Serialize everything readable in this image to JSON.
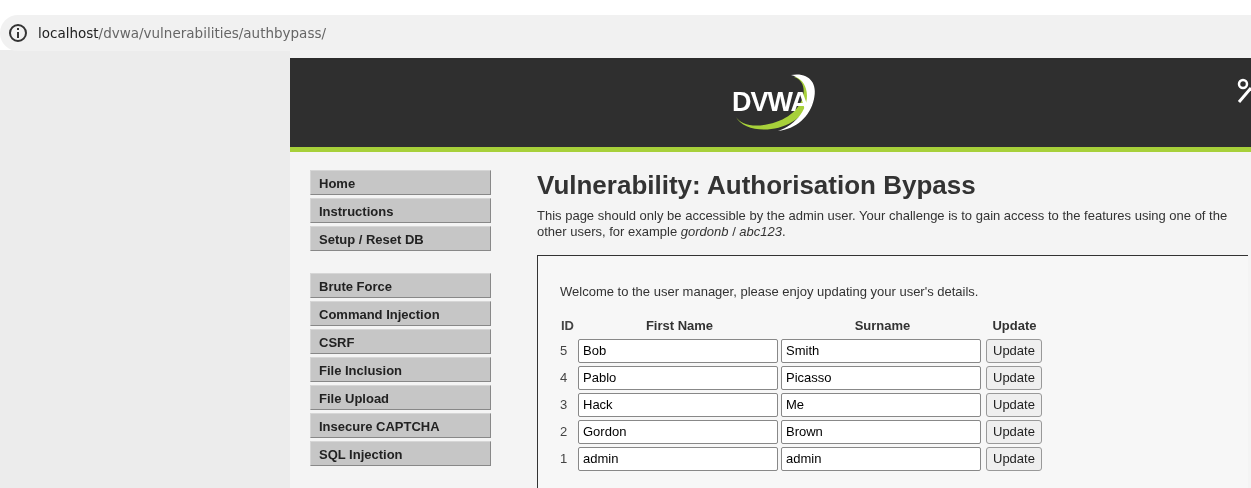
{
  "browser": {
    "url": "**localhost**/dvwa/vulnerabilities/authbypass/"
  },
  "header": {
    "logo_text": "DVWA"
  },
  "menu": [
    {
      "items": [
        {
          "label": "Home"
        },
        {
          "label": "Instructions"
        },
        {
          "label": "Setup / Reset DB"
        }
      ]
    },
    {
      "items": [
        {
          "label": "Brute Force"
        },
        {
          "label": "Command Injection"
        },
        {
          "label": "CSRF"
        },
        {
          "label": "File Inclusion"
        },
        {
          "label": "File Upload"
        },
        {
          "label": "Insecure CAPTCHA"
        },
        {
          "label": "SQL Injection"
        }
      ]
    }
  ],
  "content": {
    "title": "Vulnerability: Authorisation Bypass",
    "intro": "This page should only be accessible by the admin user. Your challenge is to gain access to the features using one of the other users, for example *gordonb* / *abc123*.",
    "welcome": "Welcome to the user manager, please enjoy updating your user's details.",
    "table": {
      "columns": [
        "ID",
        "First Name",
        "Surname",
        "Update"
      ],
      "rows": [
        {
          "id": "5",
          "first_name": "Bob",
          "surname": "Smith",
          "button": "Update"
        },
        {
          "id": "4",
          "first_name": "Pablo",
          "surname": "Picasso",
          "button": "Update"
        },
        {
          "id": "3",
          "first_name": "Hack",
          "surname": "Me",
          "button": "Update"
        },
        {
          "id": "2",
          "first_name": "Gordon",
          "surname": "Brown",
          "button": "Update"
        },
        {
          "id": "1",
          "first_name": "admin",
          "surname": "admin",
          "button": "Update"
        }
      ]
    }
  }
}
